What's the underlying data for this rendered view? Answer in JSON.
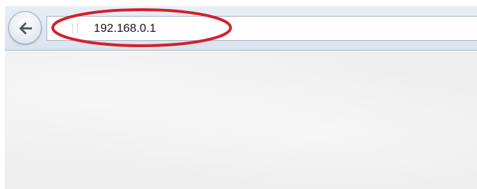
{
  "browser": {
    "address_bar": {
      "value": "192.168.0.1"
    },
    "back_button": {
      "icon": "back-arrow-icon"
    },
    "annotation": {
      "color": "#d2202b"
    }
  }
}
